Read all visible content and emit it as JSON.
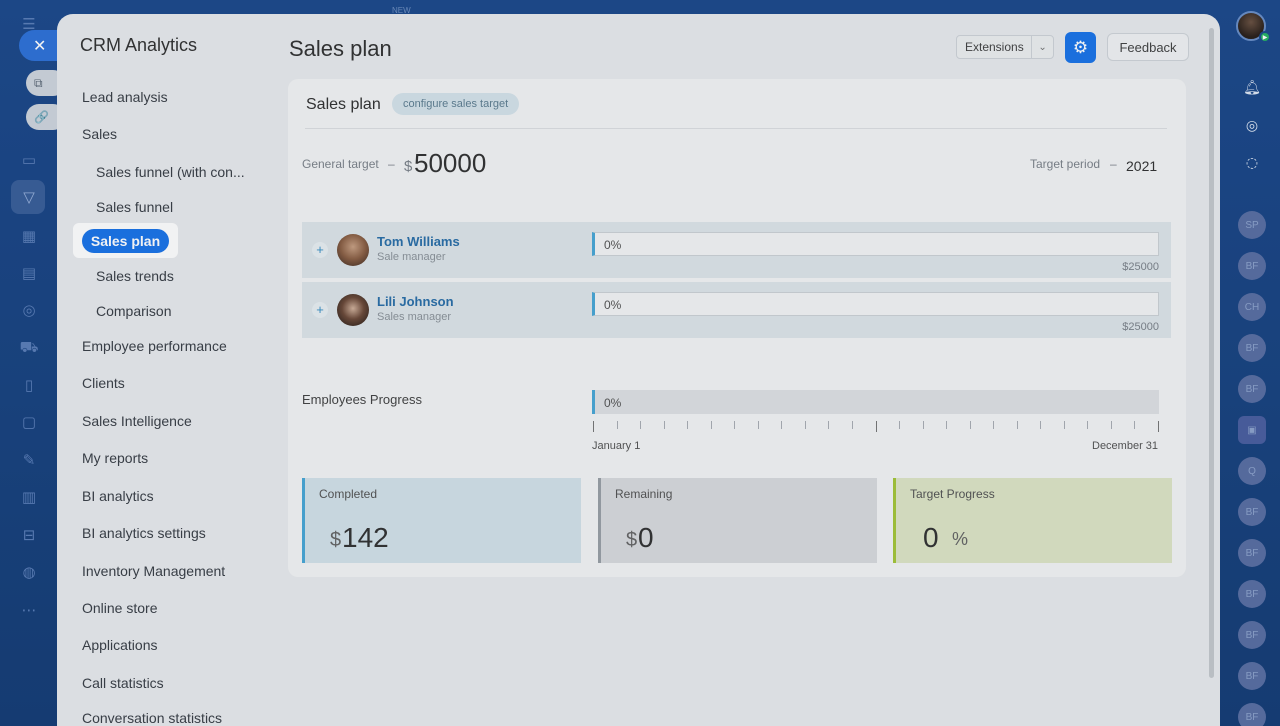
{
  "top_label": "NEW",
  "outer_nav": {
    "close_icon": "close-icon",
    "tabs": [
      {
        "icon": "external-link-icon"
      },
      {
        "icon": "link-icon"
      }
    ]
  },
  "app": {
    "title": "CRM Analytics",
    "nav": [
      {
        "label": "Lead analysis",
        "level": 0
      },
      {
        "label": "Sales",
        "level": 0
      },
      {
        "label": "Sales funnel (with con...",
        "level": 1
      },
      {
        "label": "Sales funnel",
        "level": 1
      },
      {
        "label": "Sales plan",
        "level": 1,
        "active": true
      },
      {
        "label": "Sales trends",
        "level": 1
      },
      {
        "label": "Comparison",
        "level": 1
      },
      {
        "label": "Employee performance",
        "level": 0
      },
      {
        "label": "Clients",
        "level": 0
      },
      {
        "label": "Sales Intelligence",
        "level": 0
      },
      {
        "label": "My reports",
        "level": 0
      },
      {
        "label": "BI analytics",
        "level": 0
      },
      {
        "label": "BI analytics settings",
        "level": 0
      },
      {
        "label": "Inventory Management",
        "level": 0
      },
      {
        "label": "Online store",
        "level": 0
      },
      {
        "label": "Applications",
        "level": 0
      },
      {
        "label": "Call statistics",
        "level": 0
      },
      {
        "label": "Conversation statistics",
        "level": 0
      }
    ]
  },
  "header": {
    "page_title": "Sales plan",
    "extensions_label": "Extensions",
    "feedback_label": "Feedback"
  },
  "card": {
    "title": "Sales plan",
    "config_badge": "configure sales target",
    "general_target_label": "General target",
    "dash": "–",
    "currency": "$",
    "general_target_value": "50000",
    "target_period_label": "Target period",
    "target_period_value": "2021",
    "employees": [
      {
        "name": "Tom Williams",
        "role": "Sale manager",
        "progress": "0%",
        "target": "$25000"
      },
      {
        "name": "Lili Johnson",
        "role": "Sales manager",
        "progress": "0%",
        "target": "$25000"
      }
    ],
    "employees_progress_label": "Employees Progress",
    "employees_progress_value": "0%",
    "timeline_start": "January 1",
    "timeline_end": "December 31",
    "stats": {
      "completed_label": "Completed",
      "completed_value": "142",
      "remaining_label": "Remaining",
      "remaining_value": "0",
      "target_progress_label": "Target Progress",
      "target_progress_value": "0",
      "percent_sign": "%"
    }
  },
  "right_bar": {
    "badges": [
      "SP",
      "BF",
      "CH",
      "BF",
      "BF",
      "Q",
      "BF",
      "BF",
      "BF",
      "BF",
      "BF",
      "BF"
    ]
  },
  "colors": {
    "accent": "#1b74e8",
    "completed": "#4aa7d6",
    "target_progress": "#a4c639"
  }
}
